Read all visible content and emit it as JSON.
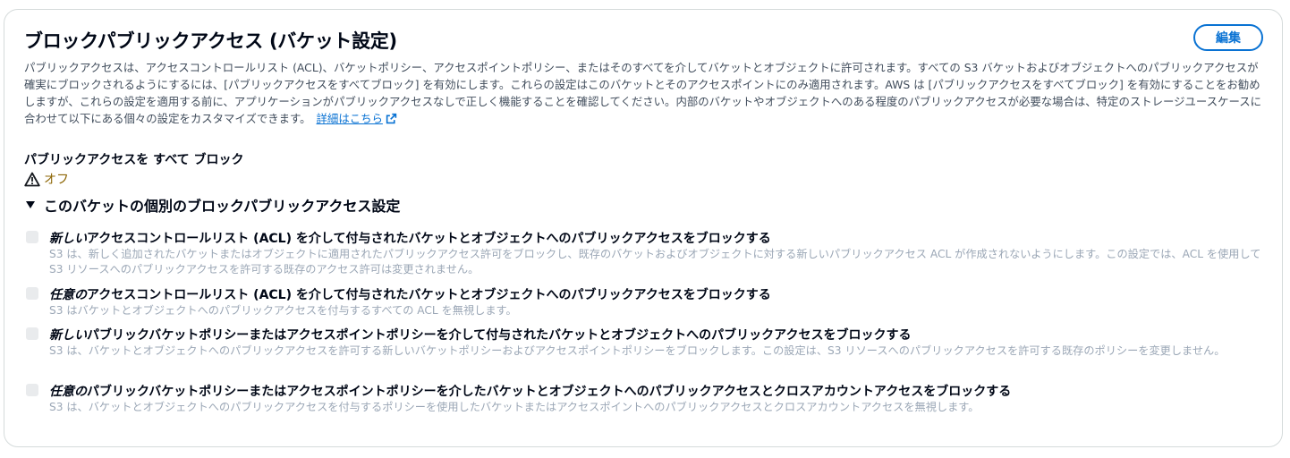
{
  "header": {
    "title": "ブロックパブリックアクセス (バケット設定)",
    "edit_label": "編集"
  },
  "description": {
    "text": "パブリックアクセスは、アクセスコントロールリスト (ACL)、バケットポリシー、アクセスポイントポリシー、またはそのすべてを介してバケットとオブジェクトに許可されます。すべての S3 バケットおよびオブジェクトへのパブリックアクセスが確実にブロックされるようにするには、[パブリックアクセスをすべてブロック] を有効にします。これらの設定はこのバケットとそのアクセスポイントにのみ適用されます。AWS は [パブリックアクセスをすべてブロック] を有効にすることをお勧めしますが、これらの設定を適用する前に、アプリケーションがパブリックアクセスなしで正しく機能することを確認してください。内部のバケットやオブジェクトへのある程度のパブリックアクセスが必要な場合は、特定のストレージユースケースに合わせて以下にある個々の設定をカスタマイズできます。",
    "link_label": "詳細はこちら"
  },
  "block_all": {
    "label": "パブリックアクセスを すべて ブロック",
    "status": "オフ",
    "status_color": "#8d6605"
  },
  "individual_section": {
    "title": "このバケットの個別のブロックパブリックアクセス設定",
    "options": [
      {
        "label_emph": "新しい",
        "label_rest": "アクセスコントロールリスト (ACL) を介して付与されたバケットとオブジェクトへのパブリックアクセスをブロックする",
        "description": "S3 は、新しく追加されたバケットまたはオブジェクトに適用されたパブリックアクセス許可をブロックし、既存のバケットおよびオブジェクトに対する新しいパブリックアクセス ACL が作成されないようにします。この設定では、ACL を使用して S3 リソースへのパブリックアクセスを許可する既存のアクセス許可は変更されません。",
        "checked": false
      },
      {
        "label_emph": "任意の",
        "label_rest": "アクセスコントロールリスト (ACL) を介して付与されたバケットとオブジェクトへのパブリックアクセスをブロックする",
        "description": "S3 はバケットとオブジェクトへのパブリックアクセスを付与するすべての ACL を無視します。",
        "checked": false
      },
      {
        "label_emph": "新しい",
        "label_rest": "パブリックバケットポリシーまたはアクセスポイントポリシーを介して付与されたバケットとオブジェクトへのパブリックアクセスをブロックする",
        "description": "S3 は、バケットとオブジェクトへのパブリックアクセスを許可する新しいバケットポリシーおよびアクセスポイントポリシーをブロックします。この設定は、S3 リソースへのパブリックアクセスを許可する既存のポリシーを変更しません。",
        "checked": false
      },
      {
        "label_emph": "任意の",
        "label_rest": "パブリックバケットポリシーまたはアクセスポイントポリシーを介したバケットとオブジェクトへのパブリックアクセスとクロスアカウントアクセスをブロックする",
        "description": "S3 は、バケットとオブジェクトへのパブリックアクセスを付与するポリシーを使用したバケットまたはアクセスポイントへのパブリックアクセスとクロスアカウントアクセスを無視します。",
        "checked": false
      }
    ]
  },
  "colors": {
    "accent": "#0972d3",
    "warning": "#8d6605",
    "disabled_text": "#9ba7b6"
  }
}
